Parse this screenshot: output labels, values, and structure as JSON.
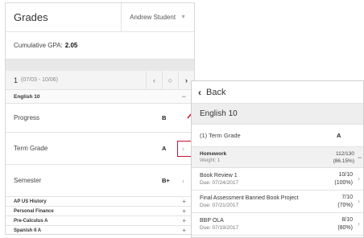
{
  "left": {
    "title": "Grades",
    "student": "Andrew Student",
    "gpa_label": "Cumulative GPA:",
    "gpa_value": "2.05",
    "term_num": "1",
    "term_dates": "(07/03 - 10/06)",
    "course": "English 10",
    "rows": [
      {
        "label": "Progress",
        "grade": "B"
      },
      {
        "label": "Term Grade",
        "grade": "A"
      },
      {
        "label": "Semester",
        "grade": "B+"
      }
    ],
    "collapsed": [
      "AP US History",
      "Personal Finance",
      "Pre-Calculus A",
      "Spanish II A"
    ]
  },
  "right": {
    "back": "Back",
    "course": "English 10",
    "term_grade_label": "(1) Term Grade",
    "term_grade_value": "A",
    "homework": {
      "name": "Homework",
      "weight": "Weight: 1",
      "score": "112/130",
      "pct": "(86.15%)"
    },
    "assignments": [
      {
        "name": "Book Review 1",
        "due": "Due: 07/24/2017",
        "score": "10/10",
        "pct": "(100%)"
      },
      {
        "name": "Final Assessment Banned Book Project",
        "due": "Due: 07/21/2017",
        "score": "7/10",
        "pct": "(70%)"
      },
      {
        "name": "BBP OLA",
        "due": "Due: 07/19/2017",
        "score": "8/10",
        "pct": "(80%)"
      }
    ]
  },
  "colors": {
    "highlight": "#c8102e",
    "band": "#e8e8e8"
  },
  "icons": [
    "chevron-down-icon",
    "chevron-left-icon",
    "circle-icon",
    "chevron-right-icon",
    "minus-icon",
    "plus-icon",
    "arrow-icon"
  ]
}
